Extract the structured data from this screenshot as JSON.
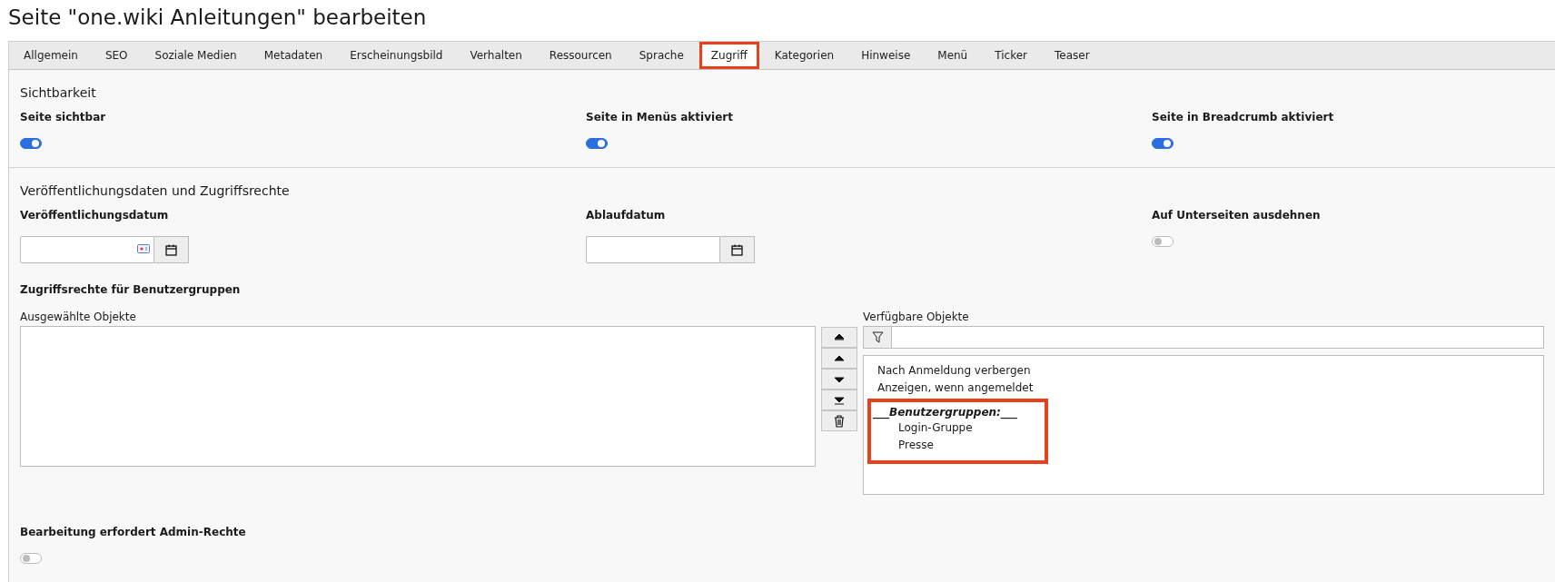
{
  "page_title": "Seite \"one.wiki Anleitungen\" bearbeiten",
  "tabs": [
    {
      "label": "Allgemein",
      "selected": false,
      "highlighted": false
    },
    {
      "label": "SEO",
      "selected": false,
      "highlighted": false
    },
    {
      "label": "Soziale Medien",
      "selected": false,
      "highlighted": false
    },
    {
      "label": "Metadaten",
      "selected": false,
      "highlighted": false
    },
    {
      "label": "Erscheinungsbild",
      "selected": false,
      "highlighted": false
    },
    {
      "label": "Verhalten",
      "selected": false,
      "highlighted": false
    },
    {
      "label": "Ressourcen",
      "selected": false,
      "highlighted": false
    },
    {
      "label": "Sprache",
      "selected": false,
      "highlighted": false
    },
    {
      "label": "Zugriff",
      "selected": true,
      "highlighted": true
    },
    {
      "label": "Kategorien",
      "selected": false,
      "highlighted": false
    },
    {
      "label": "Hinweise",
      "selected": false,
      "highlighted": false
    },
    {
      "label": "Menü",
      "selected": false,
      "highlighted": false
    },
    {
      "label": "Ticker",
      "selected": false,
      "highlighted": false
    },
    {
      "label": "Teaser",
      "selected": false,
      "highlighted": false
    }
  ],
  "visibility": {
    "heading": "Sichtbarkeit",
    "toggles": [
      {
        "label": "Seite sichtbar",
        "on": true
      },
      {
        "label": "Seite in Menüs aktiviert",
        "on": true
      },
      {
        "label": "Seite in Breadcrumb aktiviert",
        "on": true
      }
    ]
  },
  "publication": {
    "heading": "Veröffentlichungsdaten und Zugriffsrechte",
    "fields": [
      {
        "kind": "date",
        "label": "Veröffentlichungsdatum",
        "autofill_icon": true
      },
      {
        "kind": "date",
        "label": "Ablaufdatum",
        "autofill_icon": false
      },
      {
        "kind": "toggle",
        "label": "Auf Unterseiten ausdehnen",
        "on": false
      }
    ],
    "access": {
      "label": "Zugriffsrechte für Benutzergruppen",
      "selected_label": "Ausgewählte Objekte",
      "available_label": "Verfügbare Objekte",
      "available": [
        {
          "kind": "option",
          "label": "Nach Anmeldung verbergen"
        },
        {
          "kind": "option",
          "label": "Anzeigen, wenn angemeldet"
        },
        {
          "kind": "group",
          "label": "___Benutzergruppen:___",
          "highlighted": true,
          "children": [
            {
              "kind": "option",
              "label": "Login-Gruppe"
            },
            {
              "kind": "option",
              "label": "Presse"
            }
          ]
        }
      ]
    },
    "admin": {
      "label": "Bearbeitung erfordert Admin-Rechte",
      "on": false
    }
  }
}
